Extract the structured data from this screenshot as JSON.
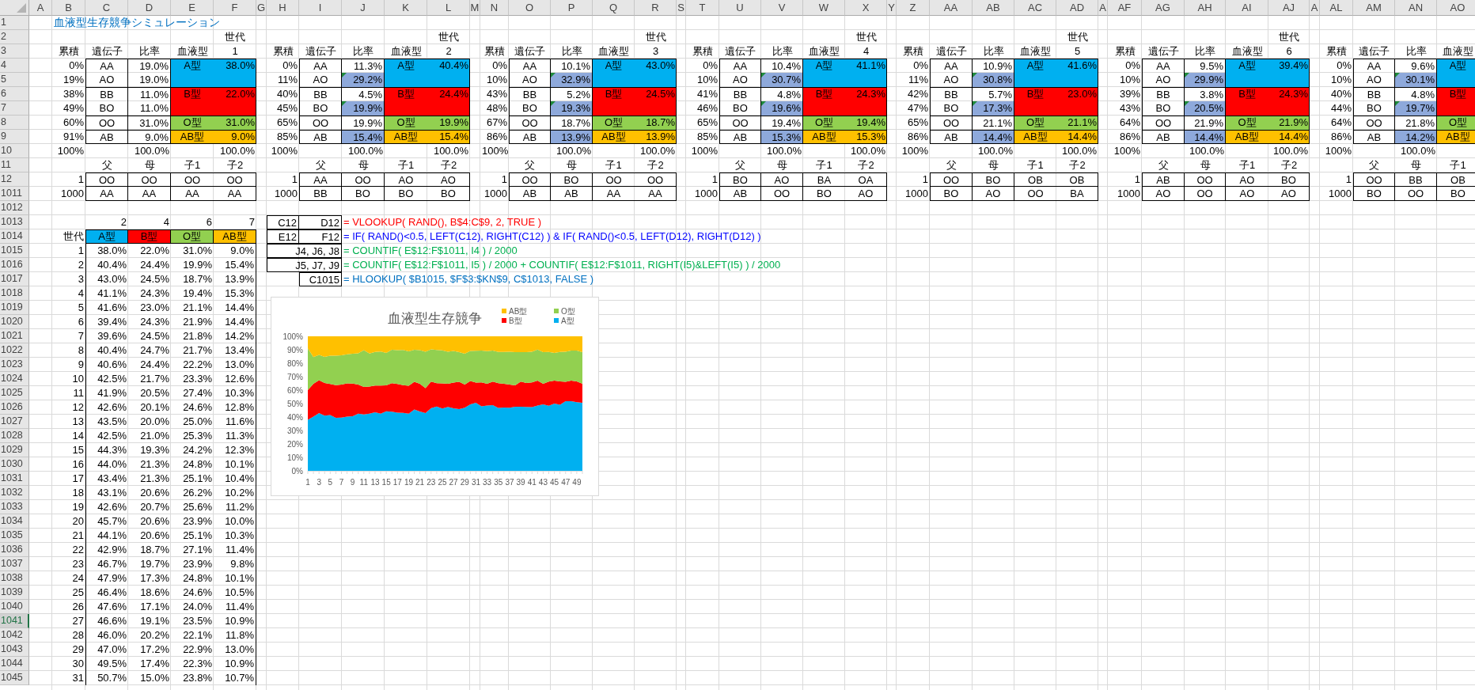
{
  "column_headers": [
    "A",
    "B",
    "C",
    "D",
    "E",
    "F",
    "G",
    "H",
    "I",
    "J",
    "K",
    "L",
    "M",
    "N",
    "O",
    "P",
    "Q",
    "R",
    "S",
    "T",
    "U",
    "V",
    "W",
    "X",
    "Y",
    "Z",
    "AA",
    "AB",
    "AC",
    "AD",
    "A",
    "AF",
    "AG",
    "AH",
    "AI",
    "AJ",
    "A",
    "AL",
    "AM",
    "AN",
    "AO"
  ],
  "row_headers": [
    {
      "label": "1",
      "selected": false
    },
    {
      "label": "2",
      "selected": false
    },
    {
      "label": "3",
      "selected": false
    },
    {
      "label": "4",
      "selected": false
    },
    {
      "label": "5",
      "selected": false
    },
    {
      "label": "6",
      "selected": false
    },
    {
      "label": "7",
      "selected": false
    },
    {
      "label": "8",
      "selected": false
    },
    {
      "label": "9",
      "selected": false
    },
    {
      "label": "10",
      "selected": false
    },
    {
      "label": "11",
      "selected": false
    },
    {
      "label": "12",
      "selected": false
    },
    {
      "label": "1011",
      "selected": false
    },
    {
      "label": "1012",
      "selected": false
    },
    {
      "label": "1013",
      "selected": false
    },
    {
      "label": "1014",
      "selected": false
    },
    {
      "label": "1015",
      "selected": false
    },
    {
      "label": "1016",
      "selected": false
    },
    {
      "label": "1017",
      "selected": false
    },
    {
      "label": "1018",
      "selected": false
    },
    {
      "label": "1019",
      "selected": false
    },
    {
      "label": "1020",
      "selected": false
    },
    {
      "label": "1021",
      "selected": false
    },
    {
      "label": "1022",
      "selected": false
    },
    {
      "label": "1023",
      "selected": false
    },
    {
      "label": "1024",
      "selected": false
    },
    {
      "label": "1025",
      "selected": false
    },
    {
      "label": "1026",
      "selected": false
    },
    {
      "label": "1027",
      "selected": false
    },
    {
      "label": "1028",
      "selected": false
    },
    {
      "label": "1029",
      "selected": false
    },
    {
      "label": "1030",
      "selected": false
    },
    {
      "label": "1031",
      "selected": false
    },
    {
      "label": "1032",
      "selected": false
    },
    {
      "label": "1033",
      "selected": false
    },
    {
      "label": "1034",
      "selected": false
    },
    {
      "label": "1035",
      "selected": false
    },
    {
      "label": "1036",
      "selected": false
    },
    {
      "label": "1037",
      "selected": false
    },
    {
      "label": "1038",
      "selected": false
    },
    {
      "label": "1039",
      "selected": false
    },
    {
      "label": "1040",
      "selected": false
    },
    {
      "label": "1041",
      "selected": true
    },
    {
      "label": "1042",
      "selected": false
    },
    {
      "label": "1043",
      "selected": false
    },
    {
      "label": "1044",
      "selected": false
    },
    {
      "label": "1045",
      "selected": false
    }
  ],
  "title": "血液型生存競争シミュレーション",
  "generations": [
    {
      "label": "世代",
      "number": "1",
      "headers": [
        "累積",
        "遺伝子",
        "比率",
        "血液型"
      ],
      "blood_types": [
        {
          "type": "A型",
          "share": "38.0%",
          "color": "#00b0f0",
          "genes": [
            {
              "cumulative": "0%",
              "gene": "AA",
              "ratio": "19.0%",
              "highlighted": false,
              "flagged": false
            },
            {
              "cumulative": "19%",
              "gene": "AO",
              "ratio": "19.0%",
              "highlighted": false,
              "flagged": false
            }
          ]
        },
        {
          "type": "B型",
          "share": "22.0%",
          "color": "#ff0000",
          "genes": [
            {
              "cumulative": "38%",
              "gene": "BB",
              "ratio": "11.0%",
              "highlighted": false,
              "flagged": false
            },
            {
              "cumulative": "49%",
              "gene": "BO",
              "ratio": "11.0%",
              "highlighted": false,
              "flagged": false
            }
          ]
        },
        {
          "type": "O型",
          "share": "31.0%",
          "color": "#92d050",
          "genes": [
            {
              "cumulative": "60%",
              "gene": "OO",
              "ratio": "31.0%",
              "highlighted": false,
              "flagged": false
            }
          ]
        },
        {
          "type": "AB型",
          "share": "9.0%",
          "color": "#ffc000",
          "genes": [
            {
              "cumulative": "91%",
              "gene": "AB",
              "ratio": "9.0%",
              "highlighted": false,
              "flagged": false
            }
          ]
        }
      ],
      "totals": {
        "cumulative": "100%",
        "ratio": "100.0%",
        "share": "100.0%"
      },
      "family_headers": [
        "父",
        "母",
        "子1",
        "子2"
      ],
      "families": [
        {
          "index": "1",
          "members": [
            "OO",
            "OO",
            "OO",
            "OO"
          ]
        },
        {
          "index": "1000",
          "members": [
            "AA",
            "AA",
            "AA",
            "AA"
          ]
        }
      ]
    },
    {
      "label": "世代",
      "number": "2",
      "headers": [
        "累積",
        "遺伝子",
        "比率",
        "血液型"
      ],
      "blood_types": [
        {
          "type": "A型",
          "share": "40.4%",
          "color": "#00b0f0",
          "genes": [
            {
              "cumulative": "0%",
              "gene": "AA",
              "ratio": "11.3%",
              "highlighted": false,
              "flagged": false
            },
            {
              "cumulative": "11%",
              "gene": "AO",
              "ratio": "29.2%",
              "highlighted": true,
              "flagged": true
            }
          ]
        },
        {
          "type": "B型",
          "share": "24.4%",
          "color": "#ff0000",
          "genes": [
            {
              "cumulative": "40%",
              "gene": "BB",
              "ratio": "4.5%",
              "highlighted": false,
              "flagged": false
            },
            {
              "cumulative": "45%",
              "gene": "BO",
              "ratio": "19.9%",
              "highlighted": true,
              "flagged": true
            }
          ]
        },
        {
          "type": "O型",
          "share": "19.9%",
          "color": "#92d050",
          "genes": [
            {
              "cumulative": "65%",
              "gene": "OO",
              "ratio": "19.9%",
              "highlighted": false,
              "flagged": false
            }
          ]
        },
        {
          "type": "AB型",
          "share": "15.4%",
          "color": "#ffc000",
          "genes": [
            {
              "cumulative": "85%",
              "gene": "AB",
              "ratio": "15.4%",
              "highlighted": true,
              "flagged": false
            }
          ]
        }
      ],
      "totals": {
        "cumulative": "100%",
        "ratio": "100.0%",
        "share": "100.0%"
      },
      "family_headers": [
        "父",
        "母",
        "子1",
        "子2"
      ],
      "families": [
        {
          "index": "1",
          "members": [
            "AA",
            "OO",
            "AO",
            "AO"
          ]
        },
        {
          "index": "1000",
          "members": [
            "BB",
            "BO",
            "BO",
            "BO"
          ]
        }
      ]
    },
    {
      "label": "世代",
      "number": "3",
      "headers": [
        "累積",
        "遺伝子",
        "比率",
        "血液型"
      ],
      "blood_types": [
        {
          "type": "A型",
          "share": "43.0%",
          "color": "#00b0f0",
          "genes": [
            {
              "cumulative": "0%",
              "gene": "AA",
              "ratio": "10.1%",
              "highlighted": false,
              "flagged": false
            },
            {
              "cumulative": "10%",
              "gene": "AO",
              "ratio": "32.9%",
              "highlighted": true,
              "flagged": true
            }
          ]
        },
        {
          "type": "B型",
          "share": "24.5%",
          "color": "#ff0000",
          "genes": [
            {
              "cumulative": "43%",
              "gene": "BB",
              "ratio": "5.2%",
              "highlighted": false,
              "flagged": false
            },
            {
              "cumulative": "48%",
              "gene": "BO",
              "ratio": "19.3%",
              "highlighted": true,
              "flagged": true
            }
          ]
        },
        {
          "type": "O型",
          "share": "18.7%",
          "color": "#92d050",
          "genes": [
            {
              "cumulative": "67%",
              "gene": "OO",
              "ratio": "18.7%",
              "highlighted": false,
              "flagged": false
            }
          ]
        },
        {
          "type": "AB型",
          "share": "13.9%",
          "color": "#ffc000",
          "genes": [
            {
              "cumulative": "86%",
              "gene": "AB",
              "ratio": "13.9%",
              "highlighted": true,
              "flagged": false
            }
          ]
        }
      ],
      "totals": {
        "cumulative": "100%",
        "ratio": "100.0%",
        "share": "100.0%"
      },
      "family_headers": [
        "父",
        "母",
        "子1",
        "子2"
      ],
      "families": [
        {
          "index": "1",
          "members": [
            "OO",
            "BO",
            "OO",
            "OO"
          ]
        },
        {
          "index": "1000",
          "members": [
            "AB",
            "AB",
            "AA",
            "AA"
          ]
        }
      ]
    },
    {
      "label": "世代",
      "number": "4",
      "headers": [
        "累積",
        "遺伝子",
        "比率",
        "血液型"
      ],
      "blood_types": [
        {
          "type": "A型",
          "share": "41.1%",
          "color": "#00b0f0",
          "genes": [
            {
              "cumulative": "0%",
              "gene": "AA",
              "ratio": "10.4%",
              "highlighted": false,
              "flagged": false
            },
            {
              "cumulative": "10%",
              "gene": "AO",
              "ratio": "30.7%",
              "highlighted": true,
              "flagged": true
            }
          ]
        },
        {
          "type": "B型",
          "share": "24.3%",
          "color": "#ff0000",
          "genes": [
            {
              "cumulative": "41%",
              "gene": "BB",
              "ratio": "4.8%",
              "highlighted": false,
              "flagged": false
            },
            {
              "cumulative": "46%",
              "gene": "BO",
              "ratio": "19.6%",
              "highlighted": true,
              "flagged": true
            }
          ]
        },
        {
          "type": "O型",
          "share": "19.4%",
          "color": "#92d050",
          "genes": [
            {
              "cumulative": "65%",
              "gene": "OO",
              "ratio": "19.4%",
              "highlighted": false,
              "flagged": false
            }
          ]
        },
        {
          "type": "AB型",
          "share": "15.3%",
          "color": "#ffc000",
          "genes": [
            {
              "cumulative": "85%",
              "gene": "AB",
              "ratio": "15.3%",
              "highlighted": true,
              "flagged": false
            }
          ]
        }
      ],
      "totals": {
        "cumulative": "100%",
        "ratio": "100.0%",
        "share": "100.0%"
      },
      "family_headers": [
        "父",
        "母",
        "子1",
        "子2"
      ],
      "families": [
        {
          "index": "1",
          "members": [
            "BO",
            "AO",
            "BA",
            "OA"
          ]
        },
        {
          "index": "1000",
          "members": [
            "AB",
            "OO",
            "BO",
            "AO"
          ]
        }
      ]
    },
    {
      "label": "世代",
      "number": "5",
      "headers": [
        "累積",
        "遺伝子",
        "比率",
        "血液型"
      ],
      "blood_types": [
        {
          "type": "A型",
          "share": "41.6%",
          "color": "#00b0f0",
          "genes": [
            {
              "cumulative": "0%",
              "gene": "AA",
              "ratio": "10.9%",
              "highlighted": false,
              "flagged": false
            },
            {
              "cumulative": "11%",
              "gene": "AO",
              "ratio": "30.8%",
              "highlighted": true,
              "flagged": true
            }
          ]
        },
        {
          "type": "B型",
          "share": "23.0%",
          "color": "#ff0000",
          "genes": [
            {
              "cumulative": "42%",
              "gene": "BB",
              "ratio": "5.7%",
              "highlighted": false,
              "flagged": false
            },
            {
              "cumulative": "47%",
              "gene": "BO",
              "ratio": "17.3%",
              "highlighted": true,
              "flagged": true
            }
          ]
        },
        {
          "type": "O型",
          "share": "21.1%",
          "color": "#92d050",
          "genes": [
            {
              "cumulative": "65%",
              "gene": "OO",
              "ratio": "21.1%",
              "highlighted": false,
              "flagged": false
            }
          ]
        },
        {
          "type": "AB型",
          "share": "14.4%",
          "color": "#ffc000",
          "genes": [
            {
              "cumulative": "86%",
              "gene": "AB",
              "ratio": "14.4%",
              "highlighted": true,
              "flagged": false
            }
          ]
        }
      ],
      "totals": {
        "cumulative": "100%",
        "ratio": "100.0%",
        "share": "100.0%"
      },
      "family_headers": [
        "父",
        "母",
        "子1",
        "子2"
      ],
      "families": [
        {
          "index": "1",
          "members": [
            "OO",
            "BO",
            "OB",
            "OB"
          ]
        },
        {
          "index": "1000",
          "members": [
            "BO",
            "AO",
            "OO",
            "BA"
          ]
        }
      ]
    },
    {
      "label": "世代",
      "number": "6",
      "headers": [
        "累積",
        "遺伝子",
        "比率",
        "血液型"
      ],
      "blood_types": [
        {
          "type": "A型",
          "share": "39.4%",
          "color": "#00b0f0",
          "genes": [
            {
              "cumulative": "0%",
              "gene": "AA",
              "ratio": "9.5%",
              "highlighted": false,
              "flagged": false
            },
            {
              "cumulative": "10%",
              "gene": "AO",
              "ratio": "29.9%",
              "highlighted": true,
              "flagged": true
            }
          ]
        },
        {
          "type": "B型",
          "share": "24.3%",
          "color": "#ff0000",
          "genes": [
            {
              "cumulative": "39%",
              "gene": "BB",
              "ratio": "3.8%",
              "highlighted": false,
              "flagged": false
            },
            {
              "cumulative": "43%",
              "gene": "BO",
              "ratio": "20.5%",
              "highlighted": true,
              "flagged": true
            }
          ]
        },
        {
          "type": "O型",
          "share": "21.9%",
          "color": "#92d050",
          "genes": [
            {
              "cumulative": "64%",
              "gene": "OO",
              "ratio": "21.9%",
              "highlighted": false,
              "flagged": false
            }
          ]
        },
        {
          "type": "AB型",
          "share": "14.4%",
          "color": "#ffc000",
          "genes": [
            {
              "cumulative": "86%",
              "gene": "AB",
              "ratio": "14.4%",
              "highlighted": true,
              "flagged": false
            }
          ]
        }
      ],
      "totals": {
        "cumulative": "100%",
        "ratio": "100.0%",
        "share": "100.0%"
      },
      "family_headers": [
        "父",
        "母",
        "子1",
        "子2"
      ],
      "families": [
        {
          "index": "1",
          "members": [
            "AB",
            "OO",
            "AO",
            "BO"
          ]
        },
        {
          "index": "1000",
          "members": [
            "AO",
            "OO",
            "AO",
            "AO"
          ]
        }
      ]
    },
    {
      "headers": [
        "累積",
        "遺伝子",
        "比率",
        "血液型"
      ],
      "blood_types": [
        {
          "type": "A型",
          "color": "#00b0f0",
          "genes": [
            {
              "cumulative": "0%",
              "gene": "AA",
              "ratio": "9.6%",
              "highlighted": false,
              "flagged": false
            },
            {
              "cumulative": "10%",
              "gene": "AO",
              "ratio": "30.1%",
              "highlighted": true,
              "flagged": true
            }
          ]
        },
        {
          "type": "B型",
          "color": "#ff0000",
          "genes": [
            {
              "cumulative": "40%",
              "gene": "BB",
              "ratio": "4.8%",
              "highlighted": false,
              "flagged": false
            },
            {
              "cumulative": "44%",
              "gene": "BO",
              "ratio": "19.7%",
              "highlighted": true,
              "flagged": true
            }
          ]
        },
        {
          "type": "O型",
          "color": "#92d050",
          "genes": [
            {
              "cumulative": "64%",
              "gene": "OO",
              "ratio": "21.8%",
              "highlighted": false,
              "flagged": false
            }
          ]
        },
        {
          "type": "AB型",
          "color": "#ffc000",
          "genes": [
            {
              "cumulative": "86%",
              "gene": "AB",
              "ratio": "14.2%",
              "highlighted": true,
              "flagged": false
            }
          ]
        }
      ],
      "totals": {
        "cumulative": "100%",
        "ratio": "100.0%"
      },
      "family_headers": [
        "父",
        "母",
        "子1"
      ],
      "families": [
        {
          "index": "1",
          "members": [
            "OO",
            "BB",
            "OB"
          ]
        },
        {
          "index": "1000",
          "members": [
            "BO",
            "OO",
            "BO"
          ]
        }
      ]
    }
  ],
  "summary": {
    "lookup_row": [
      "2",
      "4",
      "6",
      "7"
    ],
    "header_label": "世代",
    "columns": [
      {
        "label": "A型",
        "color": "#00b0f0"
      },
      {
        "label": "B型",
        "color": "#ff0000"
      },
      {
        "label": "O型",
        "color": "#92d050"
      },
      {
        "label": "AB型",
        "color": "#ffc000"
      }
    ],
    "rows": [
      {
        "generation": "1",
        "values": [
          "38.0%",
          "22.0%",
          "31.0%",
          "9.0%"
        ]
      },
      {
        "generation": "2",
        "values": [
          "40.4%",
          "24.4%",
          "19.9%",
          "15.4%"
        ]
      },
      {
        "generation": "3",
        "values": [
          "43.0%",
          "24.5%",
          "18.7%",
          "13.9%"
        ]
      },
      {
        "generation": "4",
        "values": [
          "41.1%",
          "24.3%",
          "19.4%",
          "15.3%"
        ]
      },
      {
        "generation": "5",
        "values": [
          "41.6%",
          "23.0%",
          "21.1%",
          "14.4%"
        ]
      },
      {
        "generation": "6",
        "values": [
          "39.4%",
          "24.3%",
          "21.9%",
          "14.4%"
        ]
      },
      {
        "generation": "7",
        "values": [
          "39.6%",
          "24.5%",
          "21.8%",
          "14.2%"
        ]
      },
      {
        "generation": "8",
        "values": [
          "40.4%",
          "24.7%",
          "21.7%",
          "13.4%"
        ]
      },
      {
        "generation": "9",
        "values": [
          "40.6%",
          "24.4%",
          "22.2%",
          "13.0%"
        ]
      },
      {
        "generation": "10",
        "values": [
          "42.5%",
          "21.7%",
          "23.3%",
          "12.6%"
        ]
      },
      {
        "generation": "11",
        "values": [
          "41.9%",
          "20.5%",
          "27.4%",
          "10.3%"
        ]
      },
      {
        "generation": "12",
        "values": [
          "42.6%",
          "20.1%",
          "24.6%",
          "12.8%"
        ]
      },
      {
        "generation": "13",
        "values": [
          "43.5%",
          "20.0%",
          "25.0%",
          "11.6%"
        ]
      },
      {
        "generation": "14",
        "values": [
          "42.5%",
          "21.0%",
          "25.3%",
          "11.3%"
        ]
      },
      {
        "generation": "15",
        "values": [
          "44.3%",
          "19.3%",
          "24.2%",
          "12.3%"
        ]
      },
      {
        "generation": "16",
        "values": [
          "44.0%",
          "21.3%",
          "24.8%",
          "10.1%"
        ]
      },
      {
        "generation": "17",
        "values": [
          "43.4%",
          "21.3%",
          "25.1%",
          "10.4%"
        ]
      },
      {
        "generation": "18",
        "values": [
          "43.1%",
          "20.6%",
          "26.2%",
          "10.2%"
        ]
      },
      {
        "generation": "19",
        "values": [
          "42.6%",
          "20.7%",
          "25.6%",
          "11.2%"
        ]
      },
      {
        "generation": "20",
        "values": [
          "45.7%",
          "20.6%",
          "23.9%",
          "10.0%"
        ]
      },
      {
        "generation": "21",
        "values": [
          "44.1%",
          "20.6%",
          "25.1%",
          "10.3%"
        ]
      },
      {
        "generation": "22",
        "values": [
          "42.9%",
          "18.7%",
          "27.1%",
          "11.4%"
        ]
      },
      {
        "generation": "23",
        "values": [
          "46.7%",
          "19.7%",
          "23.9%",
          "9.8%"
        ]
      },
      {
        "generation": "24",
        "values": [
          "47.9%",
          "17.3%",
          "24.8%",
          "10.1%"
        ]
      },
      {
        "generation": "25",
        "values": [
          "46.4%",
          "18.6%",
          "24.6%",
          "10.5%"
        ]
      },
      {
        "generation": "26",
        "values": [
          "47.6%",
          "17.1%",
          "24.0%",
          "11.4%"
        ]
      },
      {
        "generation": "27",
        "values": [
          "46.6%",
          "19.1%",
          "23.5%",
          "10.9%"
        ]
      },
      {
        "generation": "28",
        "values": [
          "46.0%",
          "20.2%",
          "22.1%",
          "11.8%"
        ]
      },
      {
        "generation": "29",
        "values": [
          "47.0%",
          "17.2%",
          "22.9%",
          "13.0%"
        ]
      },
      {
        "generation": "30",
        "values": [
          "49.5%",
          "17.4%",
          "22.3%",
          "10.9%"
        ]
      },
      {
        "generation": "31",
        "values": [
          "50.7%",
          "15.0%",
          "23.8%",
          "10.7%"
        ]
      }
    ]
  },
  "formula_notes": [
    {
      "kind": "pair",
      "cells": [
        "C12",
        "D12"
      ],
      "formula": "= VLOOKUP( RAND(), B$4:C$9, 2, TRUE )",
      "color": "#ff0000"
    },
    {
      "kind": "pair",
      "cells": [
        "E12",
        "F12"
      ],
      "formula": "= IF( RAND()<0.5, LEFT(C12), RIGHT(C12) ) & IF( RAND()<0.5, LEFT(D12), RIGHT(D12) )",
      "color": "#0000ff"
    },
    {
      "kind": "merged",
      "cells": [
        "J4, J6, J8"
      ],
      "formula": "= COUNTIF( E$12:F$1011, I4 ) / 2000",
      "color": "#00b050"
    },
    {
      "kind": "merged",
      "cells": [
        "J5, J7, J9"
      ],
      "formula": "= COUNTIF( E$12:F$1011, I5 ) / 2000 + COUNTIF( E$12:F$1011, RIGHT(I5)&LEFT(I5) ) / 2000",
      "color": "#00b050"
    },
    {
      "kind": "single",
      "cells": [
        "C1015"
      ],
      "formula": "= HLOOKUP( $B1015, $F$3:$KN$9, C$1013, FALSE )",
      "color": "#0070c0"
    }
  ],
  "chart": {
    "chart_data": {
      "type": "area",
      "title": "血液型生存競争",
      "stacked": true,
      "legend": "top-right",
      "x": [
        1,
        2,
        3,
        4,
        5,
        6,
        7,
        8,
        9,
        10,
        11,
        12,
        13,
        14,
        15,
        16,
        17,
        18,
        19,
        20,
        21,
        22,
        23,
        24,
        25,
        26,
        27,
        28,
        29,
        30,
        31,
        32,
        33,
        34,
        35,
        36,
        37,
        38,
        39,
        40,
        41,
        42,
        43,
        44,
        45,
        46,
        47,
        48,
        49,
        50
      ],
      "xlim": [
        1,
        50
      ],
      "xticks": [
        1,
        3,
        5,
        7,
        9,
        11,
        13,
        15,
        17,
        19,
        21,
        23,
        25,
        27,
        29,
        31,
        33,
        35,
        37,
        39,
        41,
        43,
        45,
        47,
        49
      ],
      "ylim": [
        0,
        100
      ],
      "yticks": [
        {
          "value": 0,
          "label": "0%"
        },
        {
          "value": 10,
          "label": "10%"
        },
        {
          "value": 20,
          "label": "20%"
        },
        {
          "value": 30,
          "label": "30%"
        },
        {
          "value": 40,
          "label": "40%"
        },
        {
          "value": 50,
          "label": "50%"
        },
        {
          "value": 60,
          "label": "60%"
        },
        {
          "value": 70,
          "label": "70%"
        },
        {
          "value": 80,
          "label": "80%"
        },
        {
          "value": 90,
          "label": "90%"
        },
        {
          "value": 100,
          "label": "100%"
        }
      ],
      "series": [
        {
          "name": "A型",
          "color": "#00b0f0",
          "values": [
            38.0,
            40.4,
            43.0,
            41.1,
            41.6,
            39.4,
            39.6,
            40.4,
            40.6,
            42.5,
            41.9,
            42.6,
            43.5,
            42.5,
            44.3,
            44.0,
            43.4,
            43.1,
            42.6,
            45.7,
            44.1,
            42.9,
            46.7,
            47.9,
            46.4,
            47.6,
            46.6,
            46.0,
            47.0,
            49.5,
            50.7,
            48.0,
            48.6,
            48.8,
            46.7,
            47.1,
            46.9,
            47.6,
            47.6,
            47.5,
            47.3,
            48.6,
            49.4,
            48.4,
            50.0,
            49.2,
            51.8,
            51.8,
            51.0,
            50.6
          ]
        },
        {
          "name": "B型",
          "color": "#ff0000",
          "values": [
            22.0,
            24.4,
            24.5,
            24.3,
            23.0,
            24.3,
            24.5,
            24.7,
            24.4,
            21.7,
            20.5,
            20.1,
            20.0,
            21.0,
            19.3,
            21.3,
            21.3,
            20.6,
            20.7,
            20.6,
            20.6,
            18.7,
            19.7,
            17.3,
            18.6,
            17.1,
            19.1,
            20.2,
            17.2,
            17.4,
            15.0,
            17.7,
            16.1,
            17.5,
            18.4,
            17.6,
            17.2,
            15.9,
            18.7,
            17.8,
            18.4,
            18.5,
            15.3,
            17.9,
            17.1,
            17.3,
            14.3,
            15.3,
            15.5,
            14.1
          ]
        },
        {
          "name": "O型",
          "color": "#92d050",
          "values": [
            31.0,
            19.9,
            18.7,
            19.4,
            21.1,
            21.9,
            21.8,
            21.7,
            22.2,
            23.3,
            27.4,
            24.6,
            25.0,
            25.3,
            24.2,
            24.8,
            25.1,
            26.2,
            25.6,
            23.9,
            25.1,
            27.1,
            23.9,
            24.8,
            24.6,
            24.0,
            23.5,
            22.1,
            22.9,
            22.3,
            23.8,
            23.7,
            24.3,
            23.1,
            23.3,
            23.7,
            24.5,
            24.7,
            21.9,
            22.9,
            22.9,
            23.1,
            23.5,
            22.1,
            20.5,
            21.9,
            22.5,
            22.3,
            22.9,
            23.5
          ]
        },
        {
          "name": "AB型",
          "color": "#ffc000",
          "values": [
            9.0,
            15.4,
            13.9,
            15.3,
            14.4,
            14.4,
            14.2,
            13.4,
            13.0,
            12.6,
            10.3,
            12.8,
            11.6,
            11.3,
            12.3,
            10.1,
            10.4,
            10.2,
            11.2,
            10.0,
            10.3,
            11.4,
            9.8,
            10.1,
            10.5,
            11.4,
            10.9,
            11.8,
            13.0,
            10.9,
            10.7,
            10.6,
            11.0,
            10.6,
            11.6,
            11.6,
            11.4,
            11.8,
            11.8,
            11.8,
            11.4,
            9.8,
            11.8,
            11.6,
            12.4,
            11.6,
            11.4,
            10.6,
            10.6,
            11.8
          ]
        }
      ]
    }
  }
}
